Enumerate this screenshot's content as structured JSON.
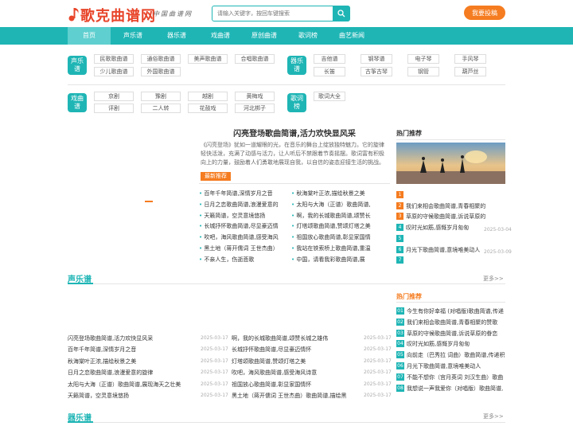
{
  "header": {
    "logo_text": "歌克曲谱网",
    "slogan": "中国曲谱网",
    "search_placeholder": "请输入关键字，按回车键搜索",
    "post_button": "我要投稿"
  },
  "nav": [
    "首页",
    "声乐谱",
    "器乐谱",
    "戏曲谱",
    "原创曲谱",
    "歌词榜",
    "曲艺新闻"
  ],
  "categories": {
    "vocal": {
      "label": "声乐谱",
      "tags": [
        "民歌歌曲谱",
        "通俗歌曲谱",
        "美声歌曲谱",
        "合唱歌曲谱",
        "少儿歌曲谱",
        "外国歌曲谱"
      ]
    },
    "instrument": {
      "label": "器乐谱",
      "tags": [
        "吉他谱",
        "钢琴谱",
        "电子琴",
        "手风琴",
        "长笛",
        "古筝古琴",
        "钢管",
        "葫芦丝"
      ]
    },
    "opera": {
      "label": "戏曲谱",
      "tags": [
        "京剧",
        "豫剧",
        "越剧",
        "黄梅戏",
        "评剧",
        "二人转",
        "花鼓戏",
        "河北梆子"
      ]
    },
    "lyrics": {
      "label": "歌词榜",
      "tags": [
        "歌词大全"
      ]
    }
  },
  "featured": {
    "title": "闪亮登场歌曲简谱,活力欢快显风采",
    "desc": "《闪亮登场》犹如一道耀眼的光，在音乐的舞台上绽放独特魅力。它的旋律轻快活泼，充满了动感与活力，让人听后不禁跟着节奏摇摆。歌词富有积极向上的力量，鼓励着人们勇敢地展现自我，以自信的姿态迎接生活的挑战。",
    "badge": "最新推荐"
  },
  "featured_list_left": [
    "百年千年简谱,深情岁月之音",
    "日月之恋歌曲简谱,浪漫爱意的",
    "天籁简谱，空灵意境悠扬",
    "长城抒怀歌曲简谱,尽显豪迈情",
    "吹吧，海风歌曲简谱,感受海风",
    "黑土地（蒋开儒词 王世杰曲）",
    "不亲人生，伤逝悲歌"
  ],
  "featured_list_right": [
    "秋海棠叶正浓,描绘秋景之美",
    "太阳与大海（正谱）歌曲简谱,",
    "啊，我的长城歌曲简谱,颂赞长",
    "灯塔颂歌曲简谱,赞颂灯塔之美",
    "祖国放心歌曲简谱,彰显家国情",
    "我站在铁索桥上歌曲简谱,重温",
    "中国，请看我彩歌曲简谱,展"
  ],
  "hot_top": {
    "title": "热门推荐",
    "items": [
      {
        "num": "1",
        "text": "",
        "date": ""
      },
      {
        "num": "2",
        "text": "我们来相会歌曲简谱,青春相聚的赞歌",
        "date": ""
      },
      {
        "num": "3",
        "text": "草原的守候歌曲简谱,诉说草原的眷恋",
        "date": ""
      },
      {
        "num": "4",
        "text": "叹时光如筋,感慨岁月匆匆",
        "date": "2025-03-04"
      },
      {
        "num": "5",
        "text": "",
        "date": ""
      },
      {
        "num": "6",
        "text": "月光下歌曲简谱,意境唯美动人",
        "date": "2025-03-09"
      },
      {
        "num": "7",
        "text": "",
        "date": ""
      }
    ]
  },
  "vocal_section": {
    "title": "声乐谱",
    "more": "更多>>",
    "left": [
      {
        "text": "闪亮登场歌曲简谱,活力欢快显风采",
        "date": "2025-03-17"
      },
      {
        "text": "百年千年简谱,深情岁月之音",
        "date": "2025-03-17"
      },
      {
        "text": "秋海棠叶正浓,描绘秋景之美",
        "date": "2025-03-17"
      },
      {
        "text": "日月之恋歌曲简谱,浪漫爱意的旋律",
        "date": "2025-03-17"
      },
      {
        "text": "太阳与大海（正谱）歌曲简谱,展现海天之壮美",
        "date": "2025-03-17"
      },
      {
        "text": "天籁简谱，空灵意境悠扬",
        "date": "2025-03-17"
      }
    ],
    "right": [
      {
        "text": "啊，我的长城歌曲简谱,颂赞长城之雄伟",
        "date": "2025-03-17"
      },
      {
        "text": "长城抒怀歌曲简谱,尽显豪迈情怀",
        "date": "2025-03-17"
      },
      {
        "text": "灯塔颂歌曲简谱,赞颂灯塔之美",
        "date": "2025-03-17"
      },
      {
        "text": "吹吧，海风歌曲简谱,感受海风诗意",
        "date": "2025-03-17"
      },
      {
        "text": "祖国放心歌曲简谱,彰显家国情怀",
        "date": "2025-03-17"
      },
      {
        "text": "黑土地（蒋开儒词 王世杰曲）歌曲简谱,描绘黑",
        "date": "2025-03-17"
      }
    ]
  },
  "hot_side": {
    "title": "热门推荐",
    "items": [
      {
        "num": "01",
        "text": "今生有你好幸福 (对唱版)歌曲简谱,传递"
      },
      {
        "num": "02",
        "text": "我们来相会歌曲简谱,青春相聚的赞歌"
      },
      {
        "num": "03",
        "text": "草原的守候歌曲简谱,诉说草原的眷恋"
      },
      {
        "num": "04",
        "text": "叹时光如筋,感慨岁月匆匆"
      },
      {
        "num": "05",
        "text": "向前走（巴秀拉 词曲）歌曲简谱,传递积"
      },
      {
        "num": "06",
        "text": "月光下歌曲简谱,意境唯美动人"
      },
      {
        "num": "07",
        "text": "不能不想你（宫月英词 刘汉生曲）歌曲"
      },
      {
        "num": "08",
        "text": "我想说一声我爱你（对唱版）歌曲简谱,"
      }
    ]
  },
  "instrument_section": {
    "title": "器乐谱",
    "more": "更多>>"
  },
  "colors": {
    "accent": "#1fb5b5",
    "orange": "#f57c20",
    "logo_red": "#e8452a"
  }
}
